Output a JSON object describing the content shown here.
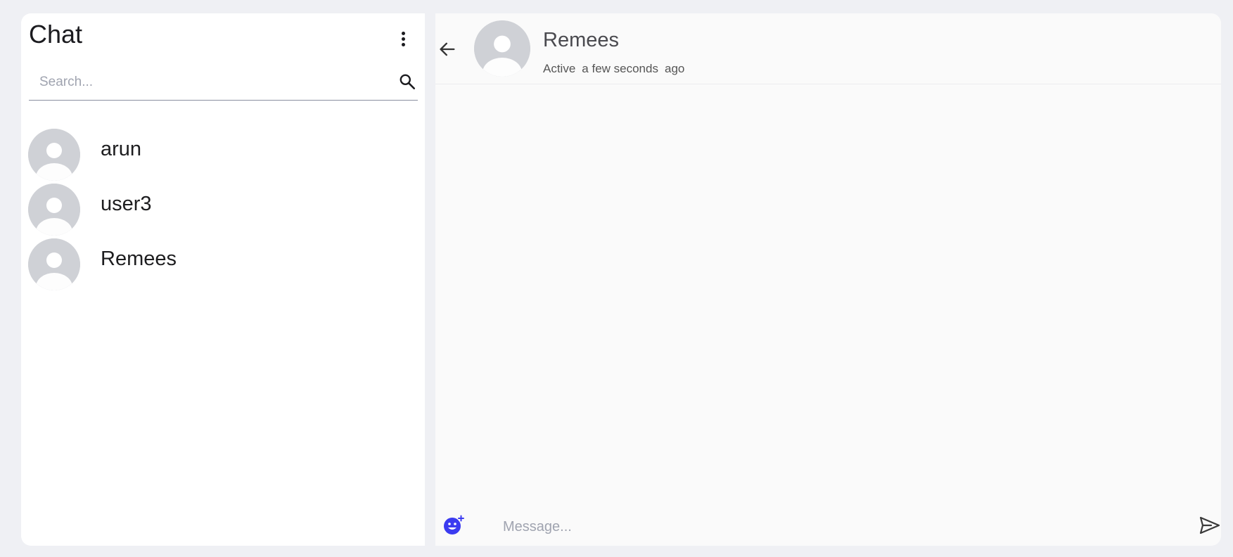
{
  "sidebar": {
    "title": "Chat",
    "menu_icon": "more-vertical-icon",
    "search": {
      "placeholder": "Search...",
      "value": "",
      "icon": "search-icon"
    },
    "contacts": [
      {
        "name": "arun",
        "avatar_icon": "default-avatar-icon"
      },
      {
        "name": "user3",
        "avatar_icon": "default-avatar-icon"
      },
      {
        "name": "Remees",
        "avatar_icon": "default-avatar-icon"
      }
    ]
  },
  "chat": {
    "back_icon": "arrow-left-icon",
    "contact_name": "Remees",
    "status": {
      "state": "Active",
      "time": "a few seconds",
      "suffix": "ago"
    },
    "composer": {
      "emoji_icon": "emoji-add-icon",
      "placeholder": "Message...",
      "value": "",
      "send_icon": "send-icon"
    }
  },
  "colors": {
    "page_background": "#eff0f4",
    "panel_background": "#ffffff",
    "chat_background": "#fafafa",
    "avatar_gray": "#cfd1d6",
    "emoji_accent": "#3b3bf0"
  }
}
